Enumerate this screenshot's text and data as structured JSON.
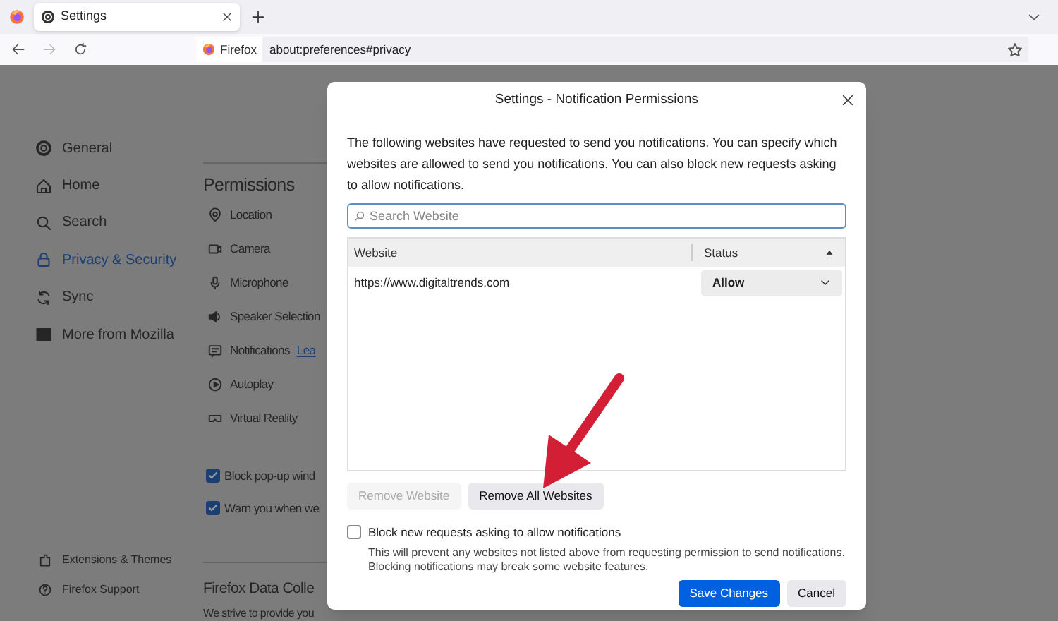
{
  "browser": {
    "tab": {
      "title": "Settings"
    },
    "identity": "Firefox",
    "url": "about:preferences#privacy"
  },
  "sidebar": {
    "items": [
      {
        "label": "General",
        "selected": false
      },
      {
        "label": "Home",
        "selected": false
      },
      {
        "label": "Search",
        "selected": false
      },
      {
        "label": "Privacy & Security",
        "selected": true
      },
      {
        "label": "Sync",
        "selected": false
      },
      {
        "label": "More from Mozilla",
        "selected": false
      }
    ],
    "footer_links": [
      "Extensions & Themes",
      "Firefox Support"
    ]
  },
  "permissions": {
    "heading": "Permissions",
    "items": [
      "Location",
      "Camera",
      "Microphone",
      "Speaker Selection",
      "Notifications",
      "Autoplay",
      "Virtual Reality"
    ],
    "link": "Lea",
    "checkboxes": [
      {
        "label": "Block pop-up wind",
        "checked": true
      },
      {
        "label": "Warn you when we",
        "checked": true
      }
    ],
    "data_heading": "Firefox Data Colle",
    "data_text": "We strive to provide you"
  },
  "dialog": {
    "title": "Settings - Notification Permissions",
    "description": "The following websites have requested to send you notifications. You can specify which websites are allowed to send you notifications. You can also block new requests asking to allow notifications.",
    "search": {
      "placeholder": "Search Website"
    },
    "columns": [
      "Website",
      "Status"
    ],
    "rows": [
      {
        "website": "https://www.digitaltrends.com",
        "status": "Allow"
      }
    ],
    "remove_website": {
      "label": "Remove Website",
      "disabled": true
    },
    "remove_all": {
      "label": "Remove All Websites",
      "disabled": false
    },
    "block_checkbox": {
      "label": "Block new requests asking to allow notifications",
      "checked": false
    },
    "note": "This will prevent any websites not listed above from requesting permission to send notifications. Blocking notifications may break some website features.",
    "buttons": [
      "Save Changes",
      "Cancel"
    ]
  }
}
